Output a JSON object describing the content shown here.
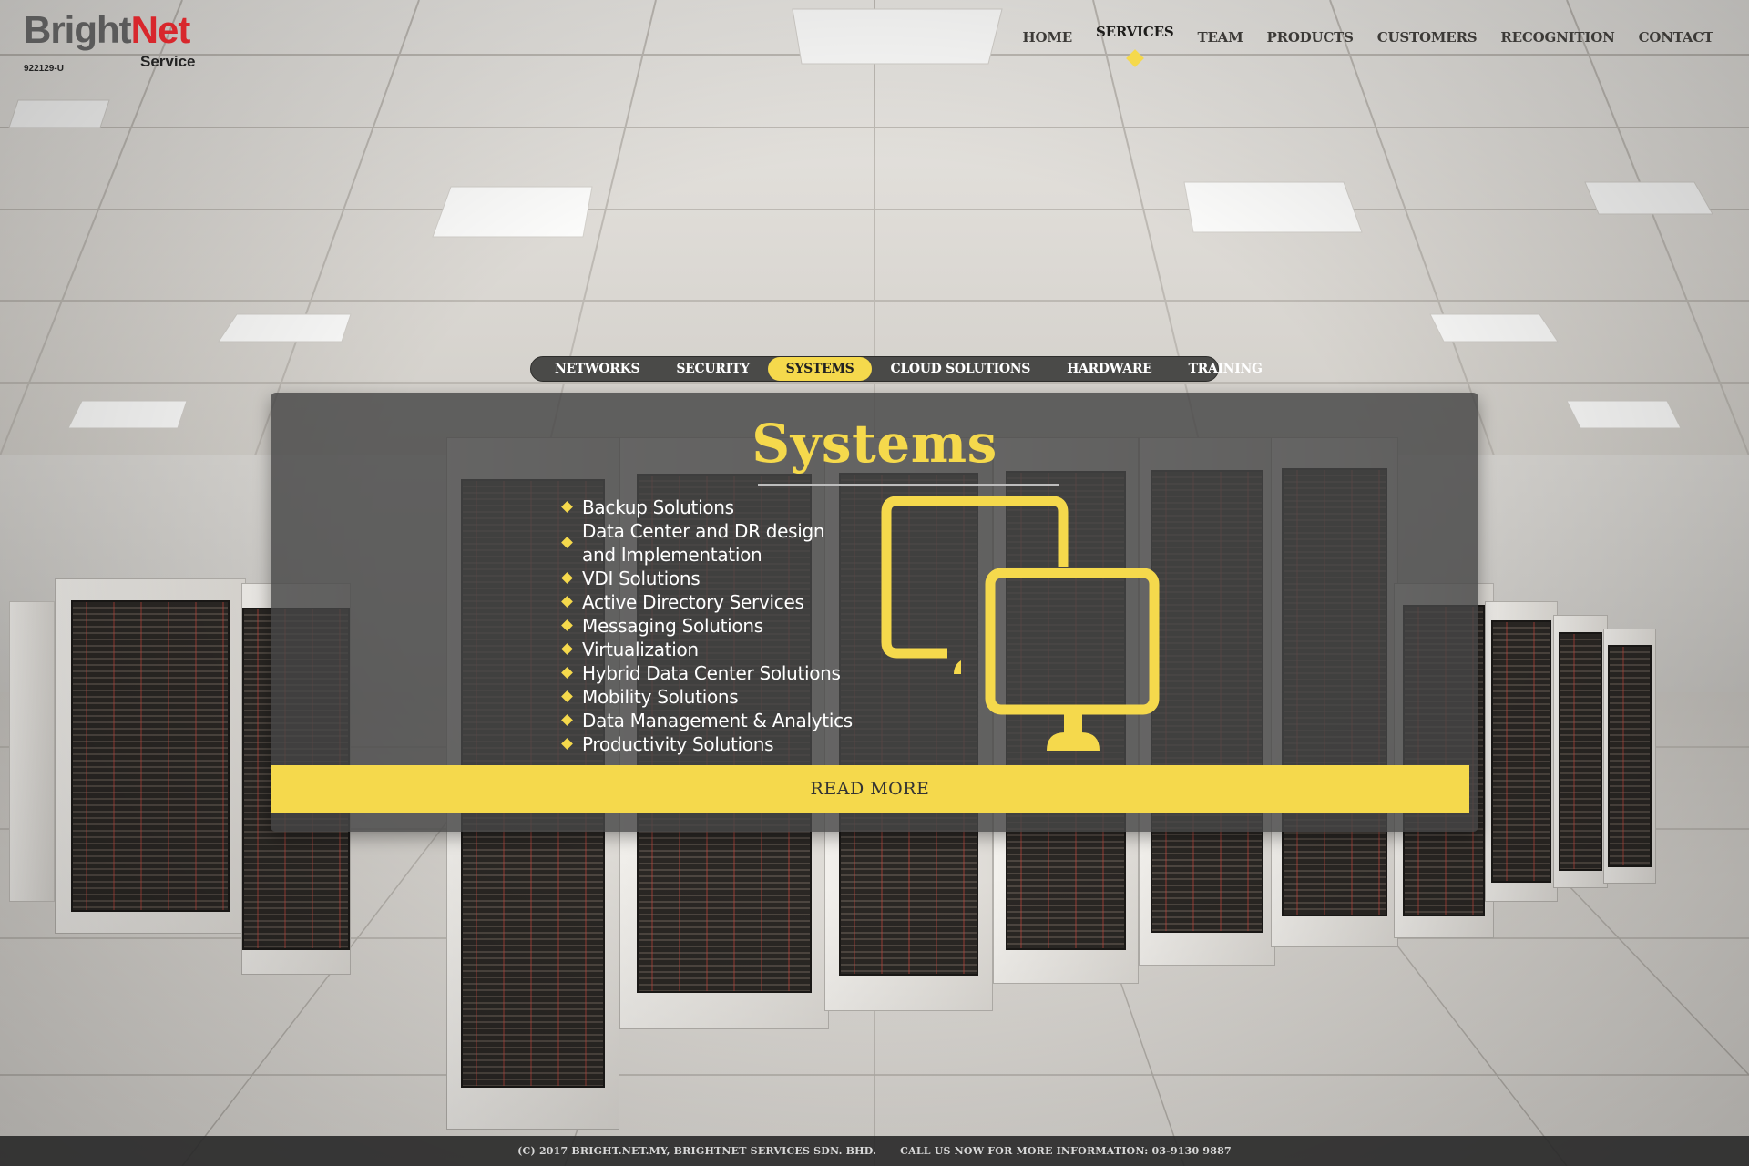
{
  "brand": {
    "name_part1": "Bright",
    "name_part2": "Net",
    "tagline": "Service",
    "registration": "922129-U"
  },
  "nav": {
    "items": [
      {
        "label": "HOME",
        "active": false
      },
      {
        "label": "SERVICES",
        "active": true
      },
      {
        "label": "TEAM",
        "active": false
      },
      {
        "label": "PRODUCTS",
        "active": false
      },
      {
        "label": "CUSTOMERS",
        "active": false
      },
      {
        "label": "RECOGNITION",
        "active": false
      },
      {
        "label": "CONTACT",
        "active": false
      }
    ]
  },
  "service_tabs": {
    "items": [
      {
        "label": "NETWORKS",
        "active": false
      },
      {
        "label": "SECURITY",
        "active": false
      },
      {
        "label": "SYSTEMS",
        "active": true
      },
      {
        "label": "CLOUD SOLUTIONS",
        "active": false
      },
      {
        "label": "HARDWARE",
        "active": false
      },
      {
        "label": "TRAINING",
        "active": false
      }
    ]
  },
  "panel": {
    "title": "Systems",
    "features": [
      "Backup Solutions",
      "Data Center and DR design and Implementation",
      "VDI Solutions",
      "Active Directory Services",
      "Messaging Solutions",
      "Virtualization",
      "Hybrid Data Center Solutions",
      "Mobility Solutions",
      "Data Management & Analytics",
      "Productivity Solutions"
    ],
    "icon": "dual-monitor-icon",
    "read_more_label": "READ MORE"
  },
  "footer": {
    "copyright": "(C) 2017 BRIGHT.NET.MY, BRIGHTNET SERVICES SDN. BHD.",
    "call_text": "CALL US NOW FOR MORE INFORMATION: 03-9130 9887"
  },
  "colors": {
    "accent": "#f5d94c",
    "brand_red": "#d8272c",
    "panel_bg": "#464646"
  }
}
